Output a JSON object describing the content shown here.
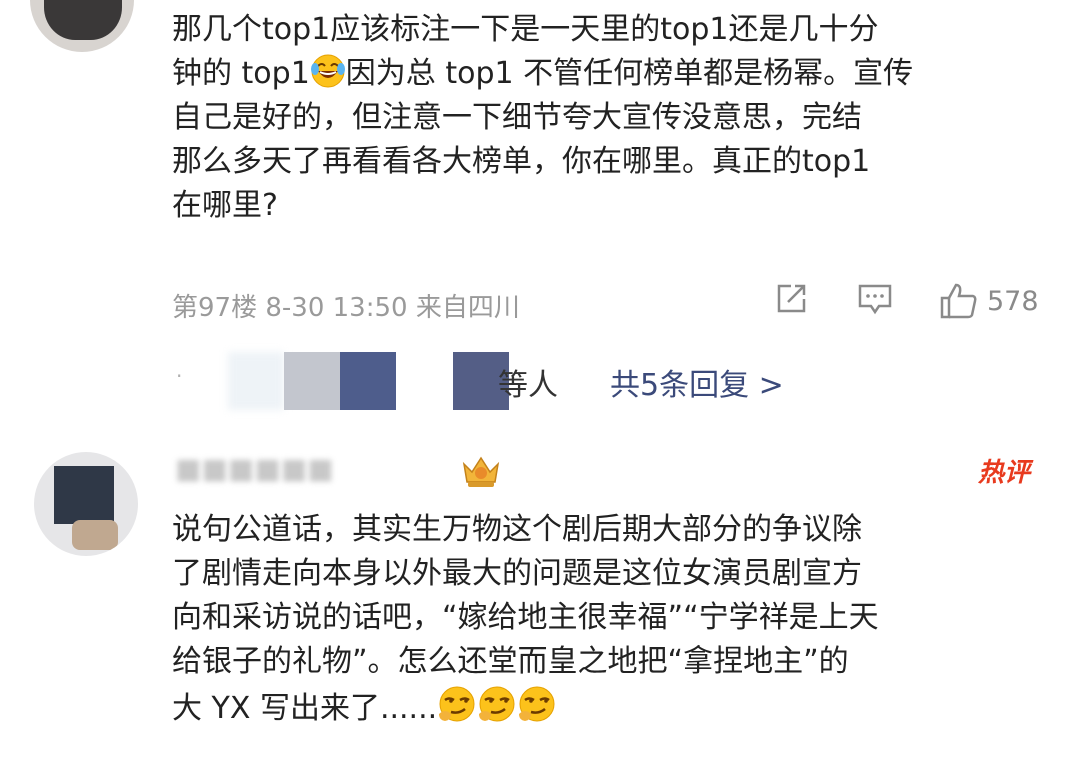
{
  "comment1": {
    "lines": [
      "那几个top1应该标注一下是一天里的top1还是几十分",
      "钟的 top1",
      "因为总 top1 不管任何榜单都是杨幂。宣传",
      "自己是好的，但注意一下细节夸大宣传没意思，完结",
      "那么多天了再看看各大榜单，你在哪里。真正的top1",
      "在哪里?"
    ],
    "meta": "第97楼 8-30 13:50 来自四川",
    "like_count": "578"
  },
  "replies": {
    "suffix": "等人",
    "total": "共5条回复 >"
  },
  "comment2": {
    "hot_badge": "热评",
    "lines": [
      "说句公道话，其实生万物这个剧后期大部分的争议除",
      "了剧情走向本身以外最大的问题是这位女演员剧宣方",
      "向和采访说的话吧，“嫁给地主很幸福”“宁学祥是上天",
      "给银子的礼物”。怎么还堂而皇之地把“拿捏地主”的",
      "大 YX 写出来了......"
    ]
  },
  "icons": [
    "laugh-cry-emoji-icon",
    "share-icon",
    "comment-icon",
    "thumbs-up-icon",
    "crown-badge-icon",
    "smirk-emoji-icon"
  ],
  "colors": {
    "hot": "#e83a1e",
    "link": "#3b4a7a",
    "meta": "#9a9a9a"
  }
}
